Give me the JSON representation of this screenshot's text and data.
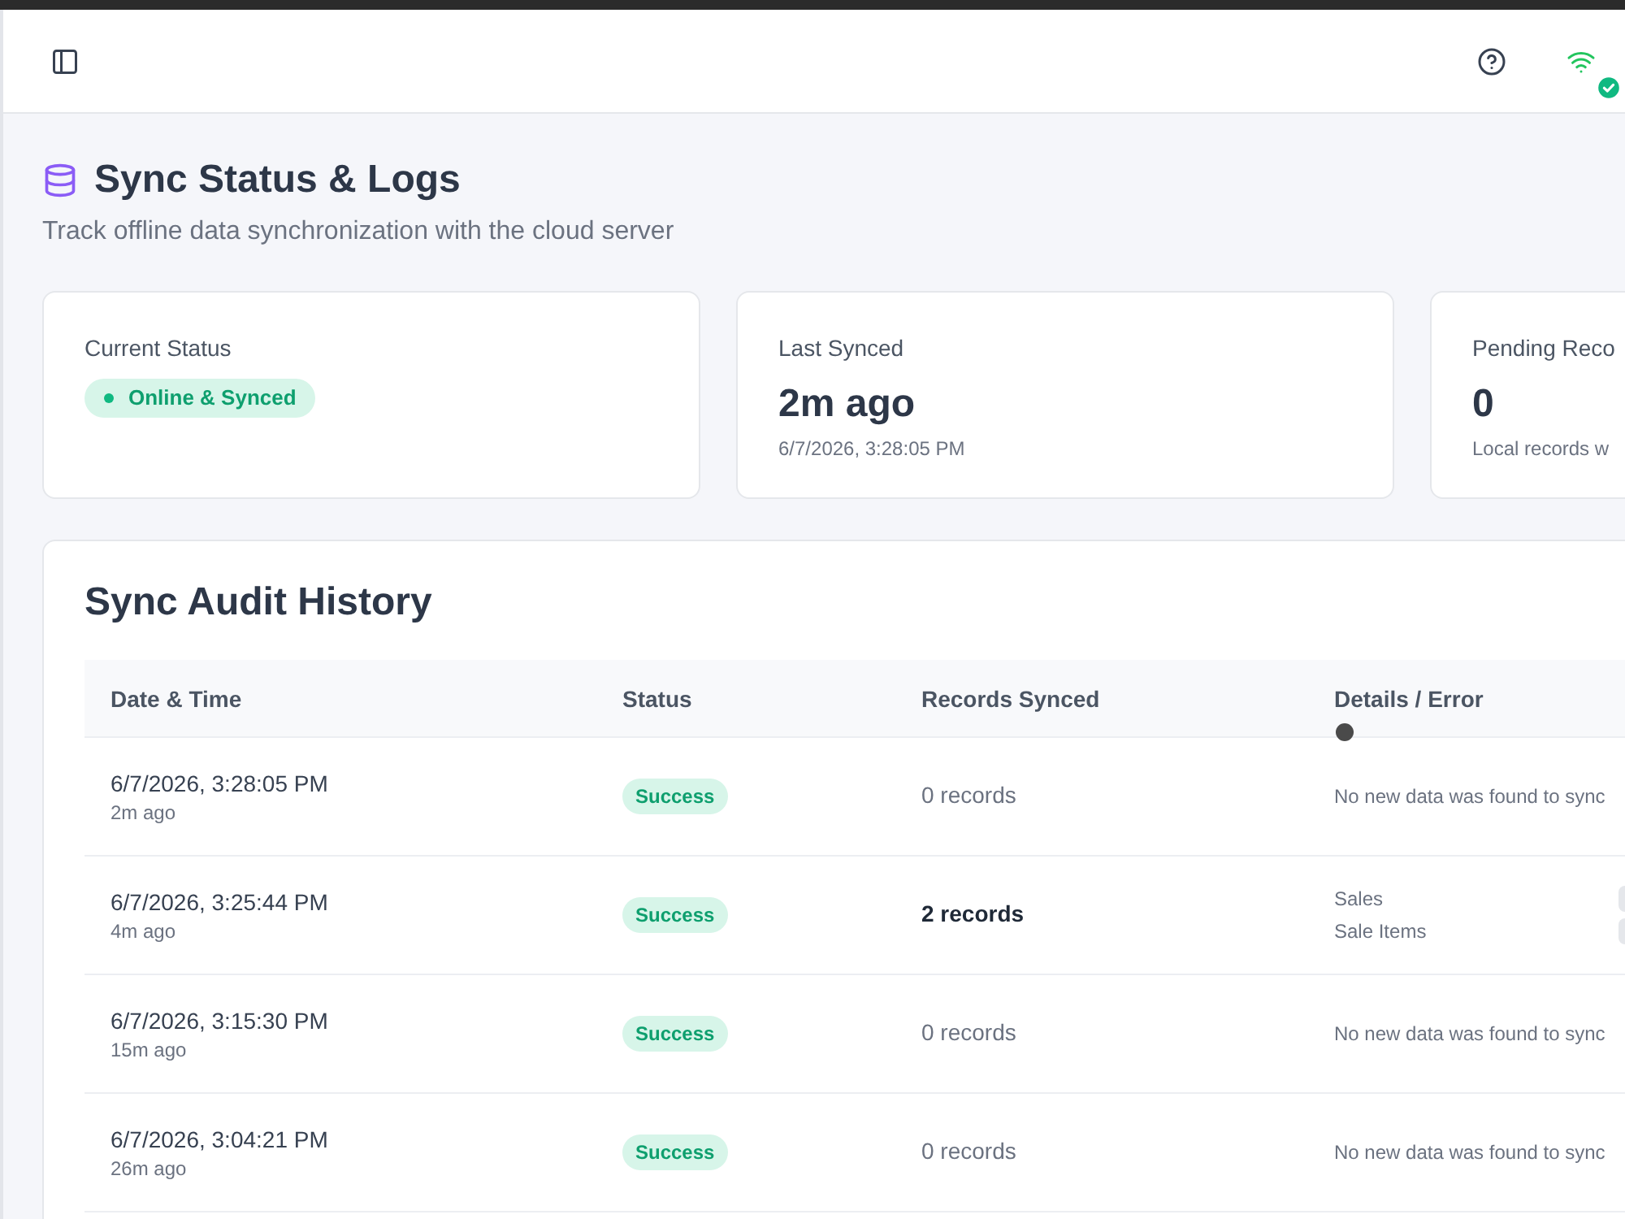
{
  "header": {
    "connection_online": true
  },
  "page": {
    "title": "Sync Status & Logs",
    "subtitle": "Track offline data synchronization with the cloud server"
  },
  "stats": [
    {
      "kind": "status",
      "label": "Current Status",
      "badge": {
        "label": "Online & Synced",
        "kind": "online"
      }
    },
    {
      "kind": "metric",
      "label": "Last Synced",
      "value": "2m ago",
      "note": "6/7/2026, 3:28:05 PM"
    },
    {
      "kind": "metric",
      "label": "Pending Reco",
      "value": "0",
      "note": "Local records w"
    }
  ],
  "history": {
    "title": "Sync Audit History",
    "columns": [
      "Date & Time",
      "Status",
      "Records Synced",
      "Details / Error"
    ],
    "rows": [
      {
        "date": "6/7/2026, 3:28:05 PM",
        "ago": "2m ago",
        "status": {
          "label": "Success",
          "kind": "success"
        },
        "records": "0 records",
        "has_records": false,
        "details": {
          "kind": "message",
          "text": "No new data was found to sync"
        }
      },
      {
        "date": "6/7/2026, 3:25:44 PM",
        "ago": "4m ago",
        "status": {
          "label": "Success",
          "kind": "success"
        },
        "records": "2 records",
        "has_records": true,
        "details": {
          "kind": "tables",
          "items": [
            "Sales",
            "Sale Items"
          ]
        }
      },
      {
        "date": "6/7/2026, 3:15:30 PM",
        "ago": "15m ago",
        "status": {
          "label": "Success",
          "kind": "success"
        },
        "records": "0 records",
        "has_records": false,
        "details": {
          "kind": "message",
          "text": "No new data was found to sync"
        }
      },
      {
        "date": "6/7/2026, 3:04:21 PM",
        "ago": "26m ago",
        "status": {
          "label": "Success",
          "kind": "success"
        },
        "records": "0 records",
        "has_records": false,
        "details": {
          "kind": "message",
          "text": "No new data was found to sync"
        }
      }
    ]
  }
}
